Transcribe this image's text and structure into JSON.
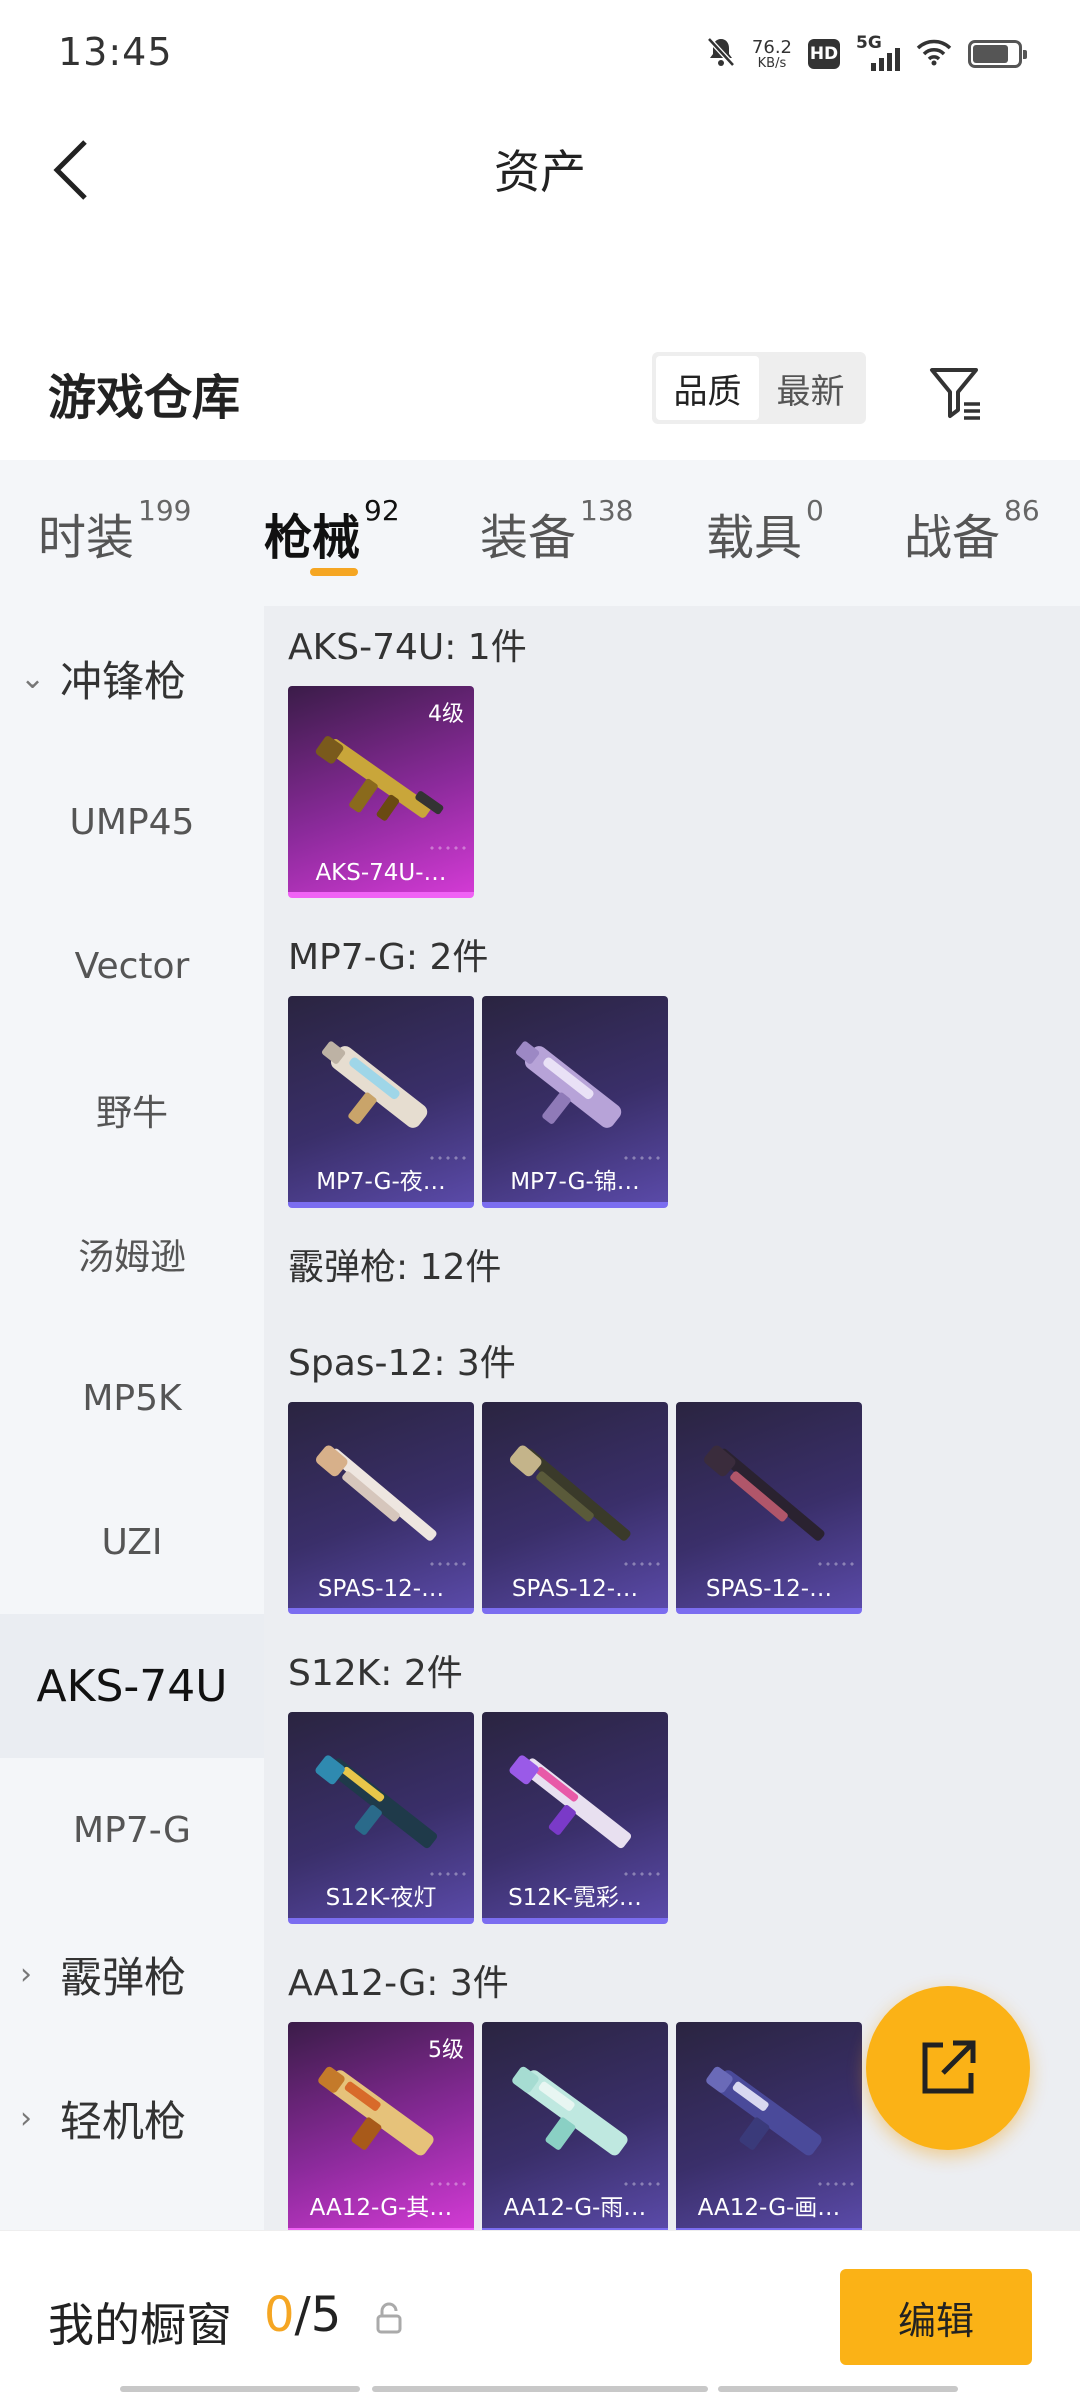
{
  "status_bar": {
    "time": "13:45",
    "net_speed_value": "76.2",
    "net_speed_unit": "KB/s",
    "hd": "HD",
    "network": "5G",
    "icons": [
      "mute-icon",
      "hd-icon",
      "signal-icon",
      "wifi-icon",
      "battery-icon"
    ]
  },
  "header": {
    "title": "资产",
    "back_icon": "chevron-left-icon"
  },
  "warehouse": {
    "title": "游戏仓库",
    "sort_options": [
      "品质",
      "最新"
    ],
    "sort_selected": "品质",
    "filter_icon": "filter-icon"
  },
  "tabs": [
    {
      "label": "时装",
      "count": "199"
    },
    {
      "label": "枪械",
      "count": "92",
      "active": true
    },
    {
      "label": "装备",
      "count": "138"
    },
    {
      "label": "载具",
      "count": "0"
    },
    {
      "label": "战备",
      "count": "86"
    }
  ],
  "sidebar": {
    "items": [
      {
        "label": "冲锋枪",
        "type": "group",
        "expanded": true
      },
      {
        "label": "UMP45"
      },
      {
        "label": "Vector"
      },
      {
        "label": "野牛"
      },
      {
        "label": "汤姆逊"
      },
      {
        "label": "MP5K"
      },
      {
        "label": "UZI"
      },
      {
        "label": "AKS-74U",
        "active": true
      },
      {
        "label": "MP7-G"
      },
      {
        "label": "霰弹枪",
        "type": "group",
        "expanded": false
      },
      {
        "label": "轻机枪",
        "type": "group",
        "expanded": false
      }
    ]
  },
  "sections": [
    {
      "title": "AKS-74U: 1件",
      "cards": [
        {
          "name": "AKS-74U-…",
          "level": "4级",
          "rarity": "pink"
        }
      ]
    },
    {
      "title": "MP7-G: 2件",
      "cards": [
        {
          "name": "MP7-G-夜…",
          "rarity": "purple"
        },
        {
          "name": "MP7-G-锦…",
          "rarity": "purple"
        }
      ]
    },
    {
      "title": "霰弹枪: 12件",
      "cards": []
    },
    {
      "title": "Spas-12: 3件",
      "cards": [
        {
          "name": "SPAS-12-…",
          "rarity": "purple"
        },
        {
          "name": "SPAS-12-…",
          "rarity": "purple"
        },
        {
          "name": "SPAS-12-…",
          "rarity": "purple"
        }
      ]
    },
    {
      "title": "S12K: 2件",
      "cards": [
        {
          "name": "S12K-夜灯",
          "rarity": "purple"
        },
        {
          "name": "S12K-霓彩…",
          "rarity": "purple"
        }
      ]
    },
    {
      "title": "AA12-G: 3件",
      "cards": [
        {
          "name": "AA12-G-其…",
          "level": "5级",
          "rarity": "pink"
        },
        {
          "name": "AA12-G-雨…",
          "rarity": "purple"
        },
        {
          "name": "AA12-G-画…",
          "rarity": "purple"
        }
      ]
    }
  ],
  "fab": {
    "icon": "share-icon"
  },
  "bottom_bar": {
    "label": "我的橱窗",
    "current": "0",
    "total": "/5",
    "lock_icon": "lock-icon",
    "edit_label": "编辑"
  },
  "colors": {
    "accent": "#fbb216",
    "tab_underline": "#f5a623",
    "card_purple": "#3a2f6a",
    "card_pink": "#d23ad4"
  }
}
